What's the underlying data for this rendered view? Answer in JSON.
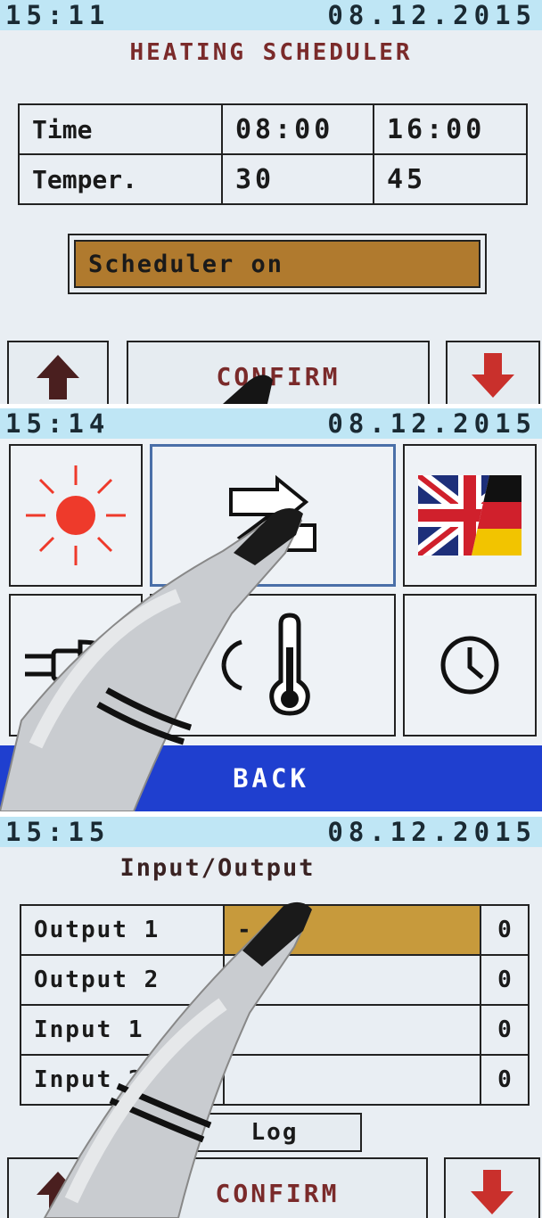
{
  "panel1": {
    "time": "15:11",
    "date": "08.12.2015",
    "title": "HEATING SCHEDULER",
    "table": {
      "rows": [
        {
          "label": "Time",
          "values": [
            "08:00",
            "16:00"
          ]
        },
        {
          "label": "Temper.",
          "values": [
            "30",
            "45"
          ]
        }
      ]
    },
    "scheduler_status": "Scheduler on",
    "buttons": {
      "confirm": "CONFIRM"
    }
  },
  "panel2": {
    "time": "15:14",
    "date": "08.12.2015",
    "icons": [
      "sun-icon",
      "arrows-exchange-icon",
      "uk-germany-flag-icon",
      "plug-icon",
      "thermometer-icon",
      "clock-icon"
    ],
    "back_label": "BACK"
  },
  "panel3": {
    "time": "15:15",
    "date": "08.12.2015",
    "title": "Input/Output",
    "rows": [
      {
        "label": "Output 1",
        "value": "-",
        "state": "0"
      },
      {
        "label": "Output 2",
        "value": "",
        "state": "0"
      },
      {
        "label": "Input 1",
        "value": "",
        "state": "0"
      },
      {
        "label": "Input 2",
        "value": "",
        "state": "0"
      }
    ],
    "log_label": "Log",
    "buttons": {
      "confirm": "CONFIRM"
    }
  },
  "colors": {
    "status_bar": "#bfe6f5",
    "title_text": "#7a2a2a",
    "scheduler_fill": "#b07a2e",
    "highlight_cell": "#c79a3c",
    "back_bar": "#1f3fcf",
    "arrow_red": "#c9302c",
    "sun_red": "#ee3a2b"
  }
}
